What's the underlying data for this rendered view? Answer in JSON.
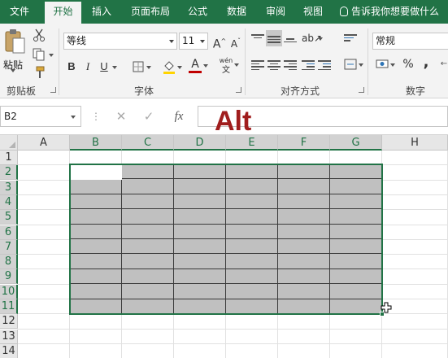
{
  "ribbon_tabs": [
    "文件",
    "开始",
    "插入",
    "页面布局",
    "公式",
    "数据",
    "审阅",
    "视图"
  ],
  "active_tab": "开始",
  "tell_me": "告诉我你想要做什么",
  "clipboard": {
    "paste_label": "粘贴",
    "group_label": "剪贴板"
  },
  "font": {
    "name": "等线",
    "size": "11",
    "group_label": "字体",
    "bold": "B",
    "italic": "I",
    "underline": "U",
    "grow": "A",
    "shrink": "A",
    "font_color": "A",
    "wen": "wén",
    "wen_char": "文"
  },
  "alignment": {
    "group_label": "对齐方式"
  },
  "number": {
    "format": "常规",
    "group_label": "数字",
    "percent": "%",
    "comma": ","
  },
  "formula_bar": {
    "name_box": "B2",
    "cancel": "✕",
    "enter": "✓",
    "fx": "fx",
    "value": ""
  },
  "overlay_text": "Alt",
  "columns": [
    "A",
    "B",
    "C",
    "D",
    "E",
    "F",
    "G",
    "H"
  ],
  "rows": [
    "1",
    "2",
    "3",
    "4",
    "5",
    "6",
    "7",
    "8",
    "9",
    "10",
    "11",
    "12",
    "13",
    "14"
  ],
  "selection": {
    "range": "B2:G11",
    "active_cell": "B2"
  },
  "colors": {
    "accent": "#217346",
    "selection_fill": "#c0c0c0",
    "overlay": "#a01d1d"
  }
}
